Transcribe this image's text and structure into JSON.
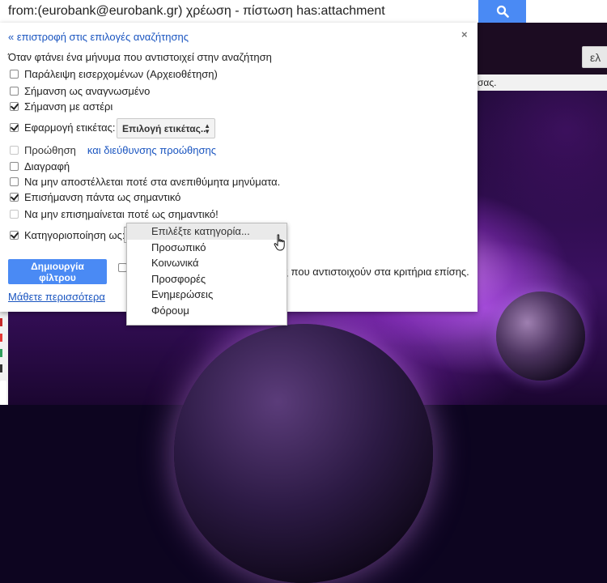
{
  "search": {
    "query": "from:(eurobank@eurobank.gr) χρέωση - πίστωση has:attachment"
  },
  "right_side": {
    "lang_label": "ελ",
    "info_text": "σας."
  },
  "filter_panel": {
    "back_link": "« επιστροφή στις επιλογές αναζήτησης",
    "close": "×",
    "description": "Όταν φτάνει ένα μήνυμα που αντιστοιχεί στην αναζήτηση",
    "options": [
      {
        "label": "Παράλειψη εισερχομένων (Αρχειοθέτηση)",
        "checked": false
      },
      {
        "label": "Σήμανση ως αναγνωσμένο",
        "checked": false
      },
      {
        "label": "Σήμανση με αστέρι",
        "checked": true
      },
      {
        "label": "Εφαρμογή ετικέτας:",
        "checked": true
      },
      {
        "label": "Προώθηση",
        "checked": false,
        "disabled": true,
        "link": "και διεύθυνσης προώθησης"
      },
      {
        "label": "Διαγραφή",
        "checked": false
      },
      {
        "label": "Να μην αποστέλλεται ποτέ στα ανεπιθύμητα μηνύματα.",
        "checked": false
      },
      {
        "label": "Επισήμανση πάντα ως σημαντικό",
        "checked": true
      },
      {
        "label": "Να μην επισημαίνεται ποτέ ως σημαντικό!",
        "checked": false,
        "disabled": true
      },
      {
        "label": "Κατηγοριοποίηση ως:",
        "checked": true
      }
    ],
    "label_select": "Επιλογή ετικέτας...",
    "create_button": "Δημιουργία φίλτρου",
    "apply_text": "ίες που αντιστοιχούν στα κριτήρια επίσης.",
    "learn_more": "Μάθετε περισσότερα"
  },
  "category_dropdown": {
    "selected": "Επιλέξτε κατηγορία...",
    "items": [
      "Επιλέξτε κατηγορία...",
      "Προσωπικό",
      "Κοινωνικά",
      "Προσφορές",
      "Ενημερώσεις",
      "Φόρουμ"
    ]
  },
  "colors": {
    "accent": "#4a8af4",
    "link": "#1a55c0"
  }
}
